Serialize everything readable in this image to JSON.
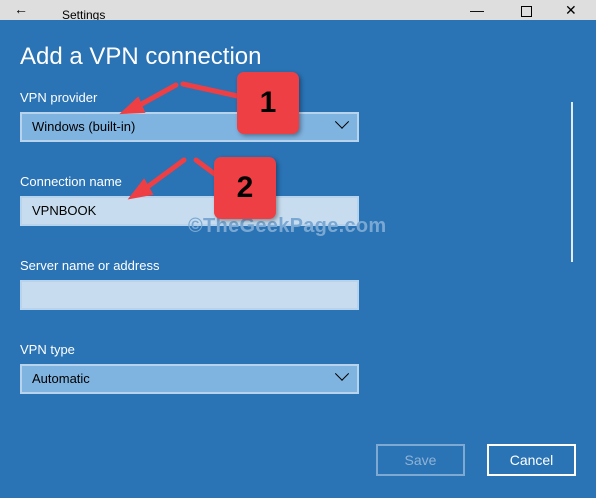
{
  "window": {
    "title": "Settings",
    "back_glyph": "←",
    "min_glyph": "—",
    "close_glyph": "✕"
  },
  "dialog": {
    "heading": "Add a VPN connection",
    "vpn_provider": {
      "label": "VPN provider",
      "value": "Windows (built-in)"
    },
    "connection_name": {
      "label": "Connection name",
      "value": "VPNBOOK"
    },
    "server": {
      "label": "Server name or address",
      "value": ""
    },
    "vpn_type": {
      "label": "VPN type",
      "value": "Automatic"
    },
    "save_label": "Save",
    "cancel_label": "Cancel"
  },
  "watermark": "©TheGeekPage.com",
  "annotations": {
    "badge_1": "1",
    "badge_2": "2"
  },
  "colors": {
    "dialog_bg": "#2a73b5",
    "badge": "#ee3f45",
    "arrow": "#ee3f45"
  }
}
